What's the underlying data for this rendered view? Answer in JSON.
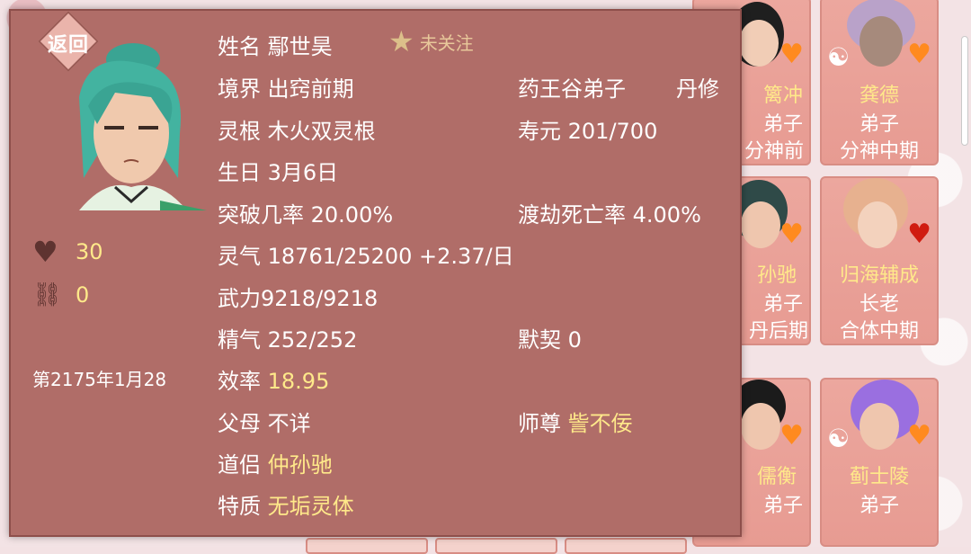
{
  "back_label": "返回",
  "follow": {
    "label": "未关注",
    "icon": "star-icon"
  },
  "character": {
    "name_label": "姓名",
    "name": "鄢世昊",
    "realm_label": "境界",
    "realm": "出窍前期",
    "sect": "药王谷弟子",
    "profession": "丹修",
    "root_label": "灵根",
    "root": "木火双灵根",
    "lifespan_label": "寿元",
    "lifespan": "201/700",
    "birthday_label": "生日",
    "birthday": "3月6日",
    "breakthrough_label": "突破几率",
    "breakthrough": "20.00%",
    "tribulation_label": "渡劫死亡率",
    "tribulation": "4.00%",
    "qi_label": "灵气",
    "qi": "18761/25200 +2.37/日",
    "force_label": "武力",
    "force": "9218/9218",
    "essence_label": "精气",
    "essence": "252/252",
    "tacit_label": "默契",
    "tacit": "0",
    "efficiency_label": "效率",
    "efficiency": "18.95",
    "parents_label": "父母",
    "parents": "不详",
    "master_label": "师尊",
    "master": "訾不佞",
    "partner_label": "道侣",
    "partner": "仲孙驰",
    "trait_label": "特质",
    "trait": "无垢灵体"
  },
  "left_stats": {
    "favor": "30",
    "bond": "0",
    "date": "第2175年1月28"
  },
  "colors": {
    "panel": "#b06d68",
    "highlight": "#ffe98a",
    "card": "#eca79e"
  },
  "cards": [
    {
      "name": "篱冲",
      "rank": "弟子",
      "level": "分神前期"
    },
    {
      "name": "龚德",
      "rank": "弟子",
      "level": "分神中期"
    },
    {
      "name": "孙驰",
      "rank": "弟子",
      "level": "丹后期"
    },
    {
      "name": "归海辅成",
      "rank": "长老",
      "level": "合体中期"
    },
    {
      "name": "儒衡",
      "rank": "弟子",
      "level": ""
    },
    {
      "name": "蓟士陵",
      "rank": "弟子",
      "level": ""
    }
  ]
}
